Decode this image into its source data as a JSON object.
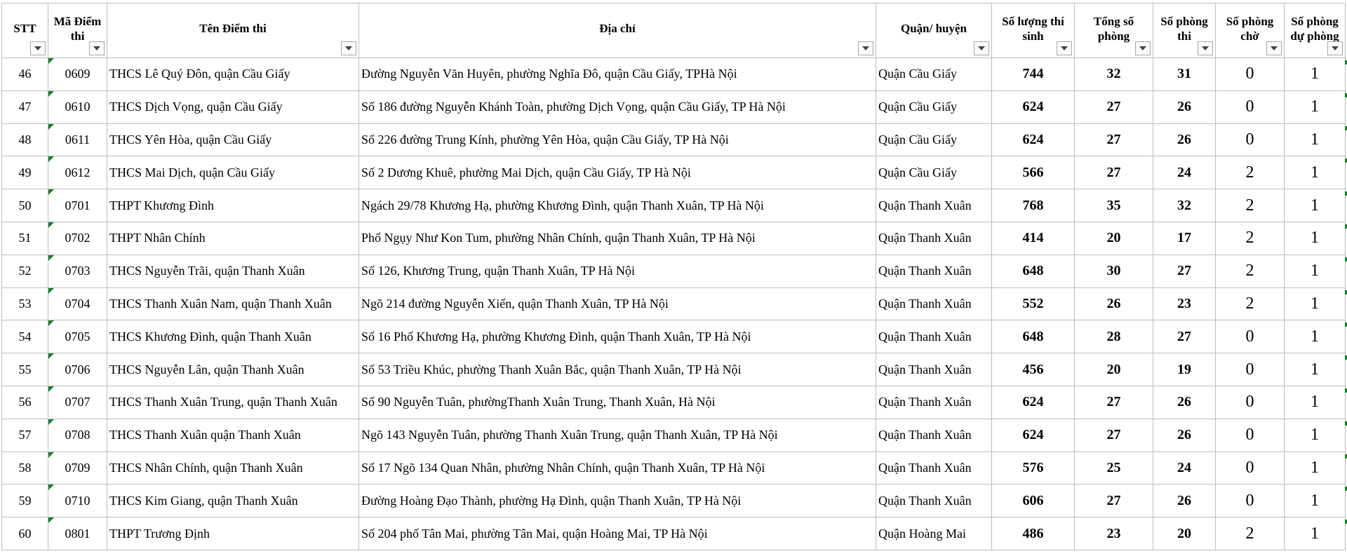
{
  "headers": [
    {
      "label": "STT"
    },
    {
      "label": "Mã Điểm thi"
    },
    {
      "label": "Tên Điểm thi"
    },
    {
      "label": "Địa chỉ"
    },
    {
      "label": "Quận/ huyện"
    },
    {
      "label": "Số lượng thí sinh"
    },
    {
      "label": "Tổng số phòng"
    },
    {
      "label": "Số phòng thi"
    },
    {
      "label": "Số phòng chờ"
    },
    {
      "label": "Số phòng dự phòng"
    }
  ],
  "rows": [
    [
      "46",
      "0609",
      "THCS Lê Quý Đôn, quận Cầu Giấy",
      "Đường Nguyễn Văn Huyên, phường Nghĩa Đô, quận Cầu Giấy, TPHà Nội",
      "Quận Cầu Giấy",
      "744",
      "32",
      "31",
      "0",
      "1"
    ],
    [
      "47",
      "0610",
      "THCS Dịch Vọng, quận Cầu Giấy",
      "Số 186 đường Nguyễn Khánh Toàn, phường Dịch Vọng, quận Cầu Giấy, TP Hà Nội",
      "Quận Cầu Giấy",
      "624",
      "27",
      "26",
      "0",
      "1"
    ],
    [
      "48",
      "0611",
      "THCS Yên Hòa, quận Cầu Giấy",
      "Số 226 đường Trung Kính, phường Yên Hòa, quận Cầu Giấy, TP Hà Nội",
      "Quận Cầu Giấy",
      "624",
      "27",
      "26",
      "0",
      "1"
    ],
    [
      "49",
      "0612",
      "THCS Mai Dịch, quận Cầu Giấy",
      "Số 2 Dương Khuê, phường Mai Dịch, quận Cầu Giấy, TP Hà Nội",
      "Quận Cầu Giấy",
      "566",
      "27",
      "24",
      "2",
      "1"
    ],
    [
      "50",
      "0701",
      "THPT Khương Đình",
      "Ngách 29/78 Khương Hạ, phường Khương Đình, quận Thanh Xuân, TP Hà Nội",
      "Quận Thanh Xuân",
      "768",
      "35",
      "32",
      "2",
      "1"
    ],
    [
      "51",
      "0702",
      "THPT Nhân Chính",
      "Phố Ngụy Như Kon Tum, phường Nhân Chính, quận Thanh Xuân, TP Hà Nội",
      "Quận Thanh Xuân",
      "414",
      "20",
      "17",
      "2",
      "1"
    ],
    [
      "52",
      "0703",
      "THCS Nguyễn Trãi, quận Thanh Xuân",
      "Số 126, Khương Trung, quận Thanh Xuân, TP Hà Nội",
      "Quận Thanh Xuân",
      "648",
      "30",
      "27",
      "2",
      "1"
    ],
    [
      "53",
      "0704",
      "THCS Thanh Xuân Nam, quận Thanh Xuân",
      "Ngõ 214 đường Nguyễn Xiển, quận Thanh Xuân, TP Hà Nội",
      "Quận Thanh Xuân",
      "552",
      "26",
      "23",
      "2",
      "1"
    ],
    [
      "54",
      "0705",
      "THCS Khương Đình, quận Thanh Xuân",
      "Số 16 Phố Khương Hạ, phường Khương Đình, quận Thanh Xuân, TP Hà Nội",
      "Quận Thanh Xuân",
      "648",
      "28",
      "27",
      "0",
      "1"
    ],
    [
      "55",
      "0706",
      "THCS Nguyễn Lân, quận Thanh Xuân",
      "Số 53 Triều Khúc, phường Thanh Xuân Bắc, quận Thanh Xuân, TP Hà Nội",
      "Quận Thanh Xuân",
      "456",
      "20",
      "19",
      "0",
      "1"
    ],
    [
      "56",
      "0707",
      "THCS Thanh Xuân Trung, quận Thanh Xuân",
      "Số 90 Nguyễn Tuân, phườngThanh Xuân Trung, Thanh Xuân, Hà Nội",
      "Quận Thanh Xuân",
      "624",
      "27",
      "26",
      "0",
      "1"
    ],
    [
      "57",
      "0708",
      "THCS Thanh Xuân quận Thanh Xuân",
      "Ngõ 143 Nguyễn Tuân, phường Thanh Xuân Trung, quận Thanh Xuân, TP Hà Nội",
      "Quận Thanh Xuân",
      "624",
      "27",
      "26",
      "0",
      "1"
    ],
    [
      "58",
      "0709",
      "THCS Nhân Chính, quận Thanh Xuân",
      "Số 17 Ngõ 134 Quan Nhân, phường Nhân Chính, quận Thanh Xuân, TP Hà Nội",
      "Quận Thanh Xuân",
      "576",
      "25",
      "24",
      "0",
      "1"
    ],
    [
      "59",
      "0710",
      "THCS Kim Giang, quận Thanh Xuân",
      "Đường Hoàng Đạo Thành, phường Hạ Đình, quận Thanh Xuân, TP Hà Nội",
      "Quận Thanh Xuân",
      "606",
      "27",
      "26",
      "0",
      "1"
    ],
    [
      "60",
      "0801",
      "THPT Trương Định",
      "Số 204 phố Tân Mai, phường Tân Mai, quận Hoàng Mai, TP Hà Nội",
      "Quận Hoàng Mai",
      "486",
      "23",
      "20",
      "2",
      "1"
    ]
  ],
  "icons": {
    "filter": "dropdown-arrow-icon",
    "marker": "green-triangle-icon"
  },
  "colors": {
    "grid": "#bdbdbd",
    "marker": "#1e7a32"
  }
}
